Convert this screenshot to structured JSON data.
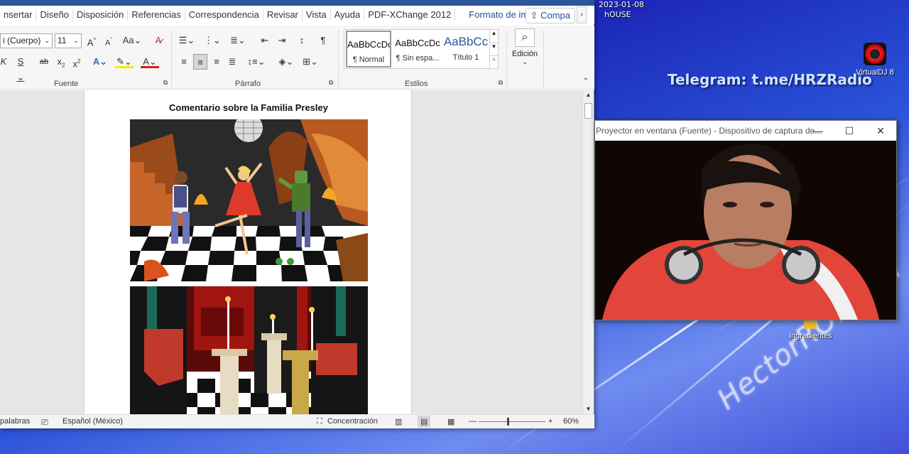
{
  "desktop": {
    "clock_date": "2023-01-08",
    "clock_label": "hOUSE",
    "telegram": "Telegram: t.me/HRZRadio",
    "watermark": "HectorROfficial",
    "icons": [
      {
        "label": "VirtualDJ 8",
        "icon": "virtualdj-icon"
      },
      {
        "label": "Ingredientes",
        "icon": "shortcut-icon"
      }
    ]
  },
  "word": {
    "tabs": [
      "nsertar",
      "Diseño",
      "Disposición",
      "Referencias",
      "Correspondencia",
      "Revisar",
      "Vista",
      "Ayuda",
      "PDF-XChange 2012",
      "Formato de imagen"
    ],
    "share_label": "Compa",
    "ribbon": {
      "font_name": "i (Cuerpo)",
      "font_size": "11",
      "group_fuente": "Fuente",
      "group_parrafo": "Párrafo",
      "group_estilos": "Estilos",
      "edicion_label": "Edición",
      "styles": [
        {
          "preview": "AaBbCcDc",
          "name": "¶ Normal"
        },
        {
          "preview": "AaBbCcDc",
          "name": "¶ Sin espa..."
        },
        {
          "preview": "AaBbCc",
          "name": "Título 1"
        }
      ]
    },
    "document": {
      "title": "Comentario sobre la Familia Presley"
    },
    "status": {
      "words": "palabras",
      "language": "Español (México)",
      "focus": "Concentración",
      "zoom": "60%",
      "zoom_level": 0.43
    }
  },
  "projector": {
    "title": "Proyector en ventana (Fuente) - Dispositivo de captura de...",
    "minimize": "—",
    "maximize": "☐",
    "close": "✕"
  },
  "colors": {
    "word_accent": "#1f4e9a",
    "desktop_blue": "#2a3fcf"
  }
}
